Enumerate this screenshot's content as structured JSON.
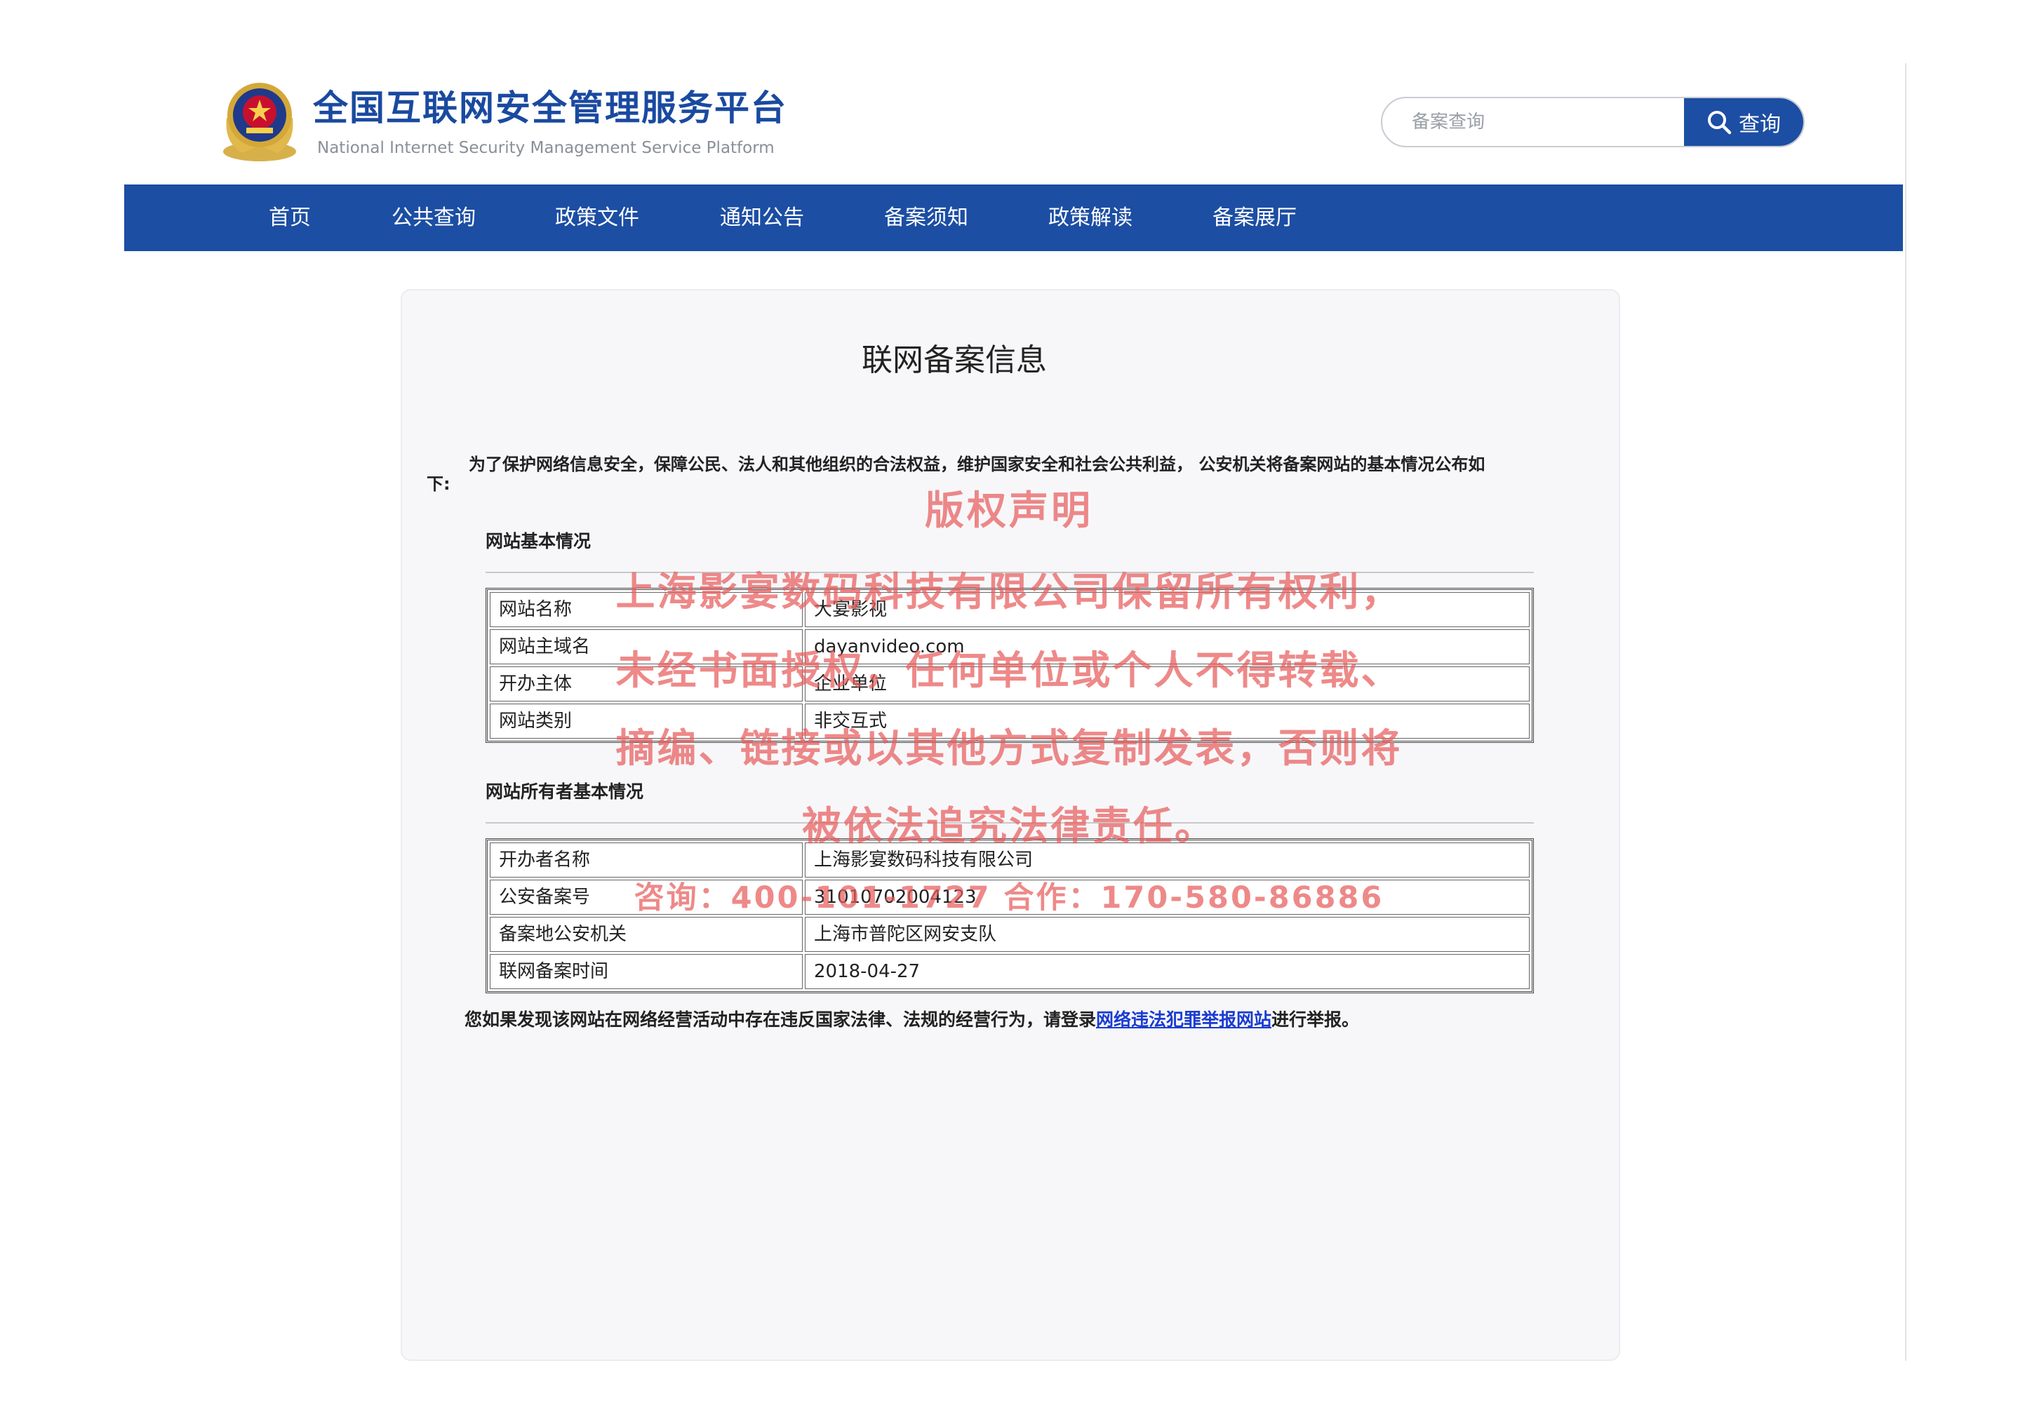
{
  "header": {
    "title": "全国互联网安全管理服务平台",
    "subtitle": "National Internet Security Management Service Platform"
  },
  "search": {
    "placeholder": "备案查询",
    "button_label": "查询",
    "icon": "search-icon"
  },
  "nav": {
    "items": [
      "首页",
      "公共查询",
      "政策文件",
      "通知公告",
      "备案须知",
      "政策解读",
      "备案展厅"
    ]
  },
  "card": {
    "title": "联网备案信息",
    "intro_line1": "为了保护网络信息安全，保障公民、法人和其他组织的合法权益，维护国家安全和社会公共利益， 公安机关将备案网站的基本情况公布如",
    "intro_line2": "下:",
    "website_section": {
      "heading": "网站基本情况",
      "rows": [
        {
          "label": "网站名称",
          "value": "大宴影视"
        },
        {
          "label": "网站主域名",
          "value": "dayanvideo.com"
        },
        {
          "label": "开办主体",
          "value": "企业单位"
        },
        {
          "label": "网站类别",
          "value": "非交互式"
        }
      ]
    },
    "owner_section": {
      "heading": "网站所有者基本情况",
      "rows": [
        {
          "label": "开办者名称",
          "value": "上海影宴数码科技有限公司"
        },
        {
          "label": "公安备案号",
          "value": "31010702004123"
        },
        {
          "label": "备案地公安机关",
          "value": "上海市普陀区网安支队"
        },
        {
          "label": "联网备案时间",
          "value": "2018-04-27"
        }
      ]
    },
    "footer": {
      "prefix": "您如果发现该网站在网络经营活动中存在违反国家法律、法规的经营行为，请登录",
      "link_text": "网络违法犯罪举报网站",
      "suffix": "进行举报。"
    }
  },
  "watermark": {
    "title": "版权声明",
    "lines": [
      "上海影宴数码科技有限公司保留所有权利，",
      "未经书面授权，任何单位或个人不得转载、",
      "摘编、链接或以其他方式复制发表，否则将",
      "被依法追究法律责任。"
    ],
    "contact": "咨询：400-101-1727 合作：170-580-86886"
  },
  "colors": {
    "brand_blue": "#1c4ea3",
    "link_blue": "#1a3bd1",
    "watermark_red": "#e85c5c"
  }
}
